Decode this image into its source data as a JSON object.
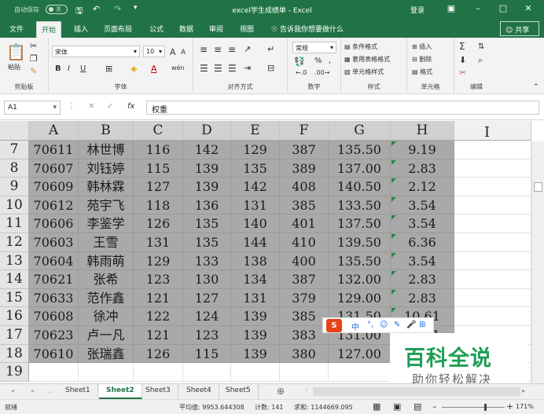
{
  "titlebar": {
    "autosave": "自动保存",
    "autosave_state": "关",
    "title": "excel学生成绩单  -  Excel",
    "login": "登录",
    "save_icon": "save-icon",
    "undo_icon": "undo-icon",
    "redo_icon": "redo-icon"
  },
  "tabs": [
    "文件",
    "开始",
    "插入",
    "页面布局",
    "公式",
    "数据",
    "审阅",
    "视图"
  ],
  "active_tab": "开始",
  "tell_me": "告诉我你想要做什么",
  "share": "共享",
  "ribbon": {
    "clipboard": {
      "label": "剪贴板",
      "paste": "粘贴"
    },
    "font": {
      "label": "字体",
      "name": "宋体",
      "size": "10",
      "bold": "B",
      "italic": "I",
      "underline": "U",
      "grow": "A",
      "shrink": "A",
      "font_color": "A",
      "wen": "wén"
    },
    "alignment": {
      "label": "对齐方式"
    },
    "number": {
      "label": "数字",
      "format": "常规",
      "percent": "%",
      "comma": ","
    },
    "styles": {
      "label": "样式",
      "items": [
        "条件格式",
        "套用表格格式",
        "单元格样式"
      ]
    },
    "cells": {
      "label": "单元格",
      "items": [
        "插入",
        "删除",
        "格式"
      ]
    },
    "editing": {
      "label": "编辑",
      "sigma": "Σ"
    }
  },
  "formula_bar": {
    "name_box": "A1",
    "fx": "fx",
    "content": "权重"
  },
  "columns": [
    "A",
    "B",
    "C",
    "D",
    "E",
    "F",
    "G",
    "H"
  ],
  "rows": [
    {
      "num": "7",
      "cells": [
        "70611",
        "林世博",
        "116",
        "142",
        "129",
        "387",
        "135.50",
        "9.19"
      ]
    },
    {
      "num": "8",
      "cells": [
        "70607",
        "刘钰婷",
        "115",
        "139",
        "135",
        "389",
        "137.00",
        "2.83"
      ]
    },
    {
      "num": "9",
      "cells": [
        "70609",
        "韩林霖",
        "127",
        "139",
        "142",
        "408",
        "140.50",
        "2.12"
      ]
    },
    {
      "num": "10",
      "cells": [
        "70612",
        "苑宇飞",
        "118",
        "136",
        "131",
        "385",
        "133.50",
        "3.54"
      ]
    },
    {
      "num": "11",
      "cells": [
        "70606",
        "李鉴学",
        "126",
        "135",
        "140",
        "401",
        "137.50",
        "3.54"
      ]
    },
    {
      "num": "12",
      "cells": [
        "70603",
        "王雪",
        "131",
        "135",
        "144",
        "410",
        "139.50",
        "6.36"
      ]
    },
    {
      "num": "13",
      "cells": [
        "70604",
        "韩雨萌",
        "129",
        "133",
        "138",
        "400",
        "135.50",
        "3.54"
      ]
    },
    {
      "num": "14",
      "cells": [
        "70621",
        "张希",
        "123",
        "130",
        "134",
        "387",
        "132.00",
        "2.83"
      ]
    },
    {
      "num": "15",
      "cells": [
        "70633",
        "范作鑫",
        "121",
        "127",
        "131",
        "379",
        "129.00",
        "2.83"
      ]
    },
    {
      "num": "16",
      "cells": [
        "70608",
        "徐冲",
        "122",
        "124",
        "139",
        "385",
        "131.50",
        "10.61"
      ]
    },
    {
      "num": "17",
      "cells": [
        "70623",
        "卢一凡",
        "121",
        "123",
        "139",
        "383",
        "131.00",
        "10.61"
      ]
    },
    {
      "num": "18",
      "cells": [
        "70610",
        "张瑞鑫",
        "126",
        "115",
        "139",
        "380",
        "127.00",
        ""
      ]
    },
    {
      "num": "19",
      "cells": [
        "",
        "",
        "",
        "",
        "",
        "",
        "",
        ""
      ]
    }
  ],
  "sheets": [
    "Sheet1",
    "Sheet2",
    "Sheet3",
    "Sheet4",
    "Sheet5"
  ],
  "active_sheet": "Sheet2",
  "status": {
    "ready": "就绪",
    "average": "平均值: 9953.644308",
    "count": "计数: 141",
    "sum": "求和: 1144669.095",
    "zoom": "171%"
  },
  "ime": {
    "logo": "S",
    "mode": "中",
    "punct": "°,"
  },
  "watermark": {
    "title": "百科全说",
    "subtitle": "助你轻松解决"
  },
  "colors": {
    "excel_green": "#217346",
    "selection": "#a9a9a9",
    "watermark_green": "#1d9f55"
  }
}
